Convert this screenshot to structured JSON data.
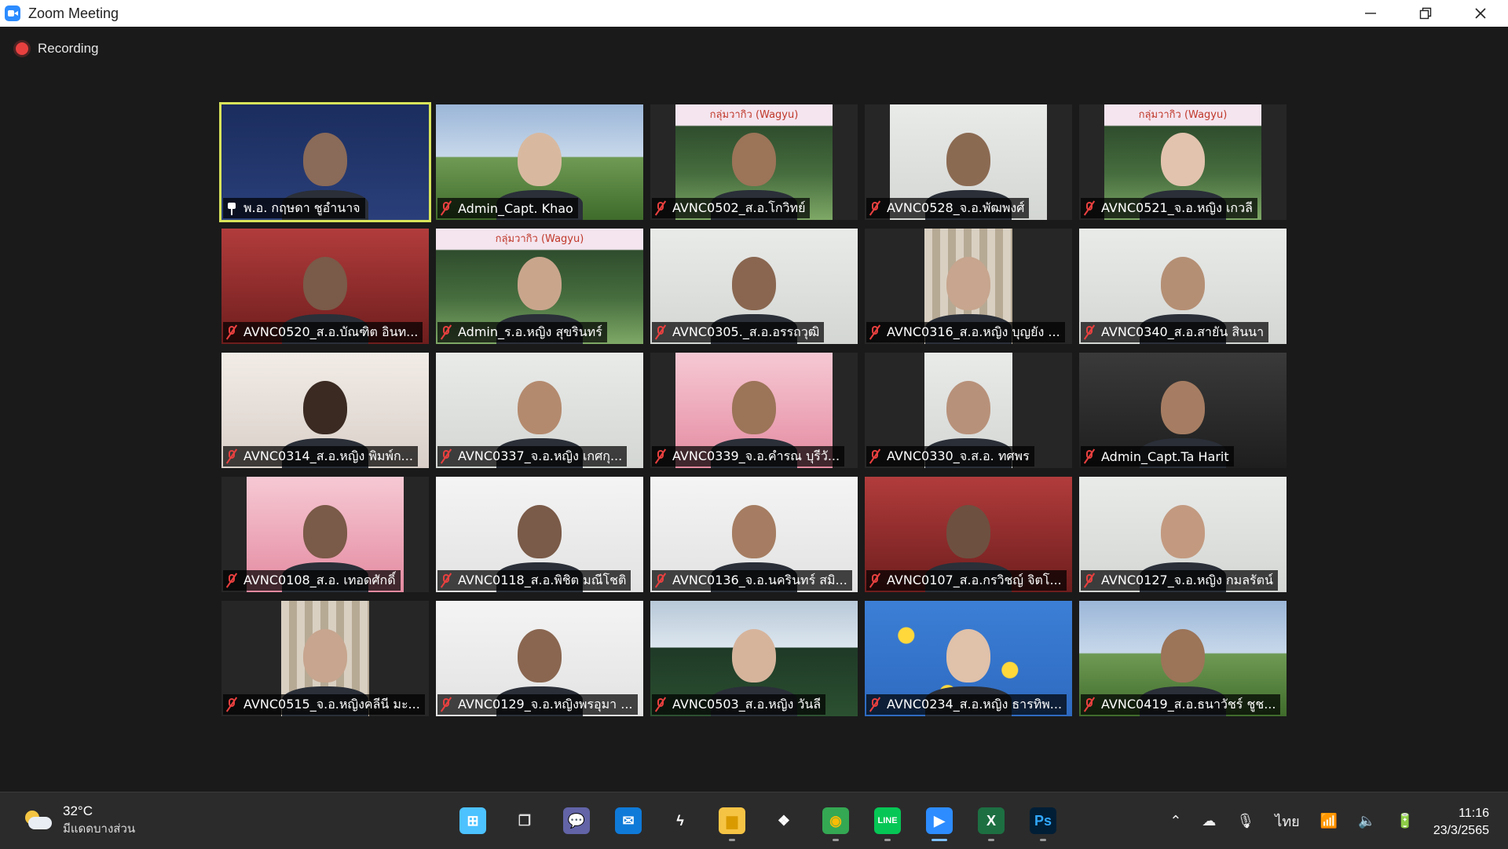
{
  "window": {
    "title": "Zoom Meeting"
  },
  "recording": {
    "label": "Recording"
  },
  "participants": [
    {
      "name": "พ.อ. กฤษดา ชูอำนาจ",
      "status": "pinned",
      "bg": "official",
      "video_width": 264,
      "skin": "#8a6a58"
    },
    {
      "name": "Admin_Capt. Khao",
      "status": "muted",
      "bg": "sky",
      "video_width": 264,
      "skin": "#d8b9a0"
    },
    {
      "name": "AVNC0502_ส.อ.โกวิทย์",
      "status": "muted",
      "bg": "forest",
      "banner": "กลุ่มวากิว (Wagyu)",
      "video_width": 200,
      "skin": "#9c7458"
    },
    {
      "name": "AVNC0528_จ.อ.พัฒพงศ์",
      "status": "muted",
      "bg": "wall",
      "video_width": 200,
      "skin": "#8b6a52"
    },
    {
      "name": "AVNC0521_จ.อ.หญิง เกวลี",
      "status": "muted",
      "bg": "forest",
      "banner": "กลุ่มวากิว (Wagyu)",
      "video_width": 200,
      "skin": "#e2c3ae"
    },
    {
      "name": "AVNC0520_ส.อ.บัณฑิต อินท...",
      "status": "muted",
      "bg": "red",
      "video_width": 264,
      "skin": "#7a5a48"
    },
    {
      "name": "Admin_ร.อ.หญิง สุขรินทร์",
      "status": "muted",
      "bg": "forest",
      "banner": "กลุ่มวากิว (Wagyu)",
      "video_width": 264,
      "skin": "#c9a58c"
    },
    {
      "name": "AVNC0305._ส.อ.อรรถวุฒิ",
      "status": "muted",
      "bg": "wall",
      "video_width": 264,
      "skin": "#8a6650"
    },
    {
      "name": "AVNC0316_ส.อ.หญิง บุญยัง ...",
      "status": "muted",
      "bg": "stripe",
      "video_width": 112,
      "skin": "#c7a58e"
    },
    {
      "name": "AVNC0340_ส.อ.สายัน สินนา",
      "status": "muted",
      "bg": "wall",
      "video_width": 264,
      "skin": "#b58f74"
    },
    {
      "name": "AVNC0314_ส.อ.หญิง พิมพ์ก...",
      "status": "muted",
      "bg": "room",
      "video_width": 264,
      "skin": "#3a2a22"
    },
    {
      "name": "AVNC0337_จ.อ.หญิง เกศกุ...",
      "status": "muted",
      "bg": "wall",
      "video_width": 264,
      "skin": "#b48a6e"
    },
    {
      "name": "AVNC0339_จ.อ.คำรณ บุรีวั...",
      "status": "muted",
      "bg": "pink",
      "video_width": 200,
      "skin": "#9c7458"
    },
    {
      "name": "AVNC0330_จ.ส.อ. ทศพร",
      "status": "muted",
      "bg": "wall",
      "video_width": 112,
      "skin": "#b8917a"
    },
    {
      "name": "Admin_Capt.Ta Harit",
      "status": "muted",
      "bg": "dark",
      "video_width": 264,
      "skin": "#a67d62"
    },
    {
      "name": "AVNC0108_ส.อ. เทอดศักดิ์",
      "status": "muted",
      "bg": "pink",
      "video_width": 200,
      "skin": "#7a5a48"
    },
    {
      "name": "AVNC0118_ส.อ.พิชิต มณีโชติ",
      "status": "muted",
      "bg": "banner",
      "video_width": 264,
      "skin": "#7a5a48"
    },
    {
      "name": "AVNC0136_จ.อ.นครินทร์ สมิ...",
      "status": "muted",
      "bg": "banner",
      "video_width": 264,
      "skin": "#a67d62"
    },
    {
      "name": "AVNC0107_ส.อ.กรวิชญ์ จิตโ...",
      "status": "muted",
      "bg": "red",
      "video_width": 264,
      "skin": "#6e5040"
    },
    {
      "name": "AVNC0127_จ.อ.หญิง กมลรัตน์",
      "status": "muted",
      "bg": "wall",
      "video_width": 264,
      "skin": "#c39a80"
    },
    {
      "name": "AVNC0515_จ.อ.หญิงคลีนี มะ...",
      "status": "muted",
      "bg": "stripe",
      "video_width": 112,
      "skin": "#c7a58e"
    },
    {
      "name": "AVNC0129_จ.อ.หญิงพรอุมา ...",
      "status": "muted",
      "bg": "banner",
      "video_width": 264,
      "skin": "#8a6650"
    },
    {
      "name": "AVNC0503_ส.อ.หญิง วันลี",
      "status": "muted",
      "bg": "cloud",
      "video_width": 264,
      "skin": "#d6b49c"
    },
    {
      "name": "AVNC0234_ส.อ.หญิง ธารทิพ...",
      "status": "muted",
      "bg": "duck",
      "video_width": 264,
      "skin": "#e0c1aa"
    },
    {
      "name": "AVNC0419_ส.อ.ธนาวัชร์ ชูช...",
      "status": "muted",
      "bg": "sky",
      "video_width": 264,
      "skin": "#9c7458"
    }
  ],
  "taskbar": {
    "weather": {
      "temp": "32°C",
      "desc": "มีแดดบางส่วน"
    },
    "apps": [
      {
        "name": "windows-start-icon",
        "label": "⊞",
        "color": "#4cc2ff",
        "fg": "#fff",
        "running": false
      },
      {
        "name": "task-view-icon",
        "label": "❐",
        "color": "transparent",
        "fg": "#ddd",
        "running": false
      },
      {
        "name": "teams-chat-icon",
        "label": "💬",
        "color": "#6264a7",
        "fg": "#fff",
        "running": false
      },
      {
        "name": "mail-icon",
        "label": "✉",
        "color": "#0f7ad8",
        "fg": "#fff",
        "running": false
      },
      {
        "name": "app-bolt-icon",
        "label": "ϟ",
        "color": "transparent",
        "fg": "#fff",
        "running": false
      },
      {
        "name": "file-explorer-icon",
        "label": "▆",
        "color": "#f6c445",
        "fg": "#d99a00",
        "running": true
      },
      {
        "name": "dropbox-icon",
        "label": "❖",
        "color": "transparent",
        "fg": "#fff",
        "running": false
      },
      {
        "name": "chrome-icon",
        "label": "◉",
        "color": "#34a853",
        "fg": "#fbbc05",
        "running": true
      },
      {
        "name": "line-icon",
        "label": "LINE",
        "color": "#06c755",
        "fg": "#fff",
        "running": true
      },
      {
        "name": "zoom-icon",
        "label": "▶",
        "color": "#2d8cff",
        "fg": "#fff",
        "running": true,
        "active": true
      },
      {
        "name": "excel-icon",
        "label": "X",
        "color": "#1d6f42",
        "fg": "#fff",
        "running": true
      },
      {
        "name": "photoshop-icon",
        "label": "Ps",
        "color": "#001e36",
        "fg": "#31a8ff",
        "running": true
      }
    ],
    "tray": {
      "lang": "ไทย"
    },
    "clock": {
      "time": "11:16",
      "date": "23/3/2565"
    }
  }
}
